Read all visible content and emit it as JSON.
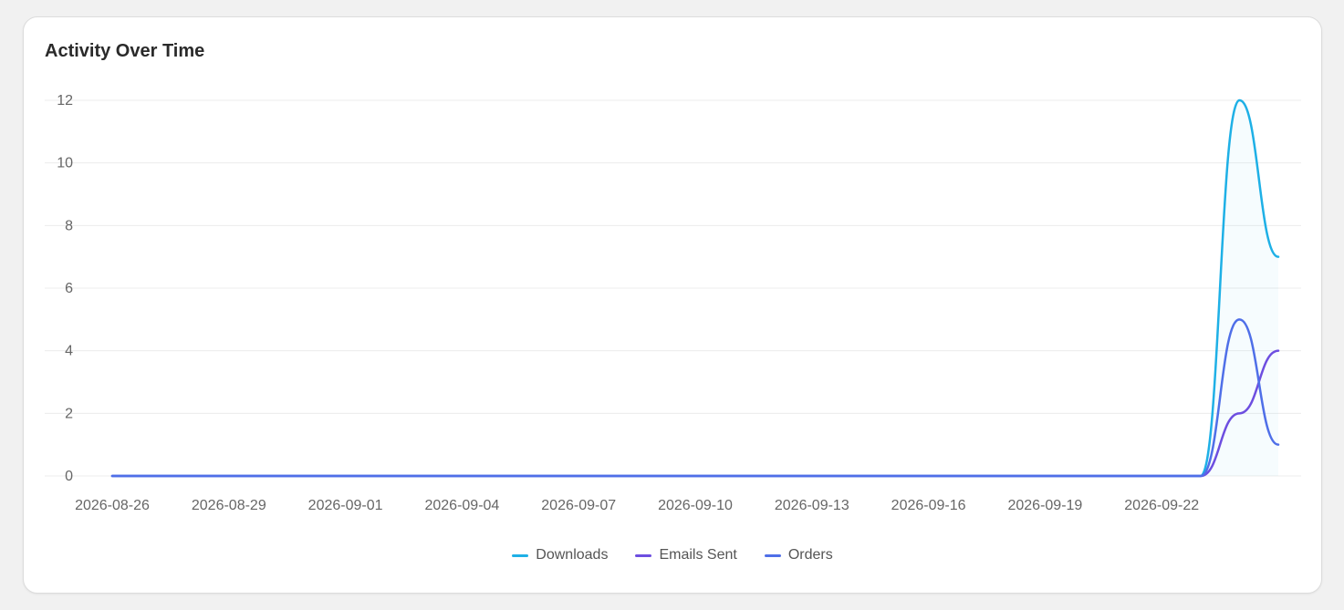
{
  "card": {
    "title": "Activity Over Time"
  },
  "chart_data": {
    "type": "line",
    "title": "Activity Over Time",
    "x": [
      "2026-08-26",
      "2026-08-27",
      "2026-08-28",
      "2026-08-29",
      "2026-08-30",
      "2026-08-31",
      "2026-09-01",
      "2026-09-02",
      "2026-09-03",
      "2026-09-04",
      "2026-09-05",
      "2026-09-06",
      "2026-09-07",
      "2026-09-08",
      "2026-09-09",
      "2026-09-10",
      "2026-09-11",
      "2026-09-12",
      "2026-09-13",
      "2026-09-14",
      "2026-09-15",
      "2026-09-16",
      "2026-09-17",
      "2026-09-18",
      "2026-09-19",
      "2026-09-20",
      "2026-09-21",
      "2026-09-22",
      "2026-09-23",
      "2026-09-24",
      "2026-09-25"
    ],
    "x_tick_labels": [
      "2026-08-26",
      "2026-08-29",
      "2026-09-01",
      "2026-09-04",
      "2026-09-07",
      "2026-09-10",
      "2026-09-13",
      "2026-09-16",
      "2026-09-19",
      "2026-09-22"
    ],
    "y_ticks": [
      0,
      2,
      4,
      6,
      8,
      10,
      12
    ],
    "ylim": [
      0,
      12
    ],
    "grid": true,
    "legend_position": "bottom-center",
    "series": [
      {
        "name": "Downloads",
        "color": "#1eb0e6",
        "values": [
          0,
          0,
          0,
          0,
          0,
          0,
          0,
          0,
          0,
          0,
          0,
          0,
          0,
          0,
          0,
          0,
          0,
          0,
          0,
          0,
          0,
          0,
          0,
          0,
          0,
          0,
          0,
          0,
          0,
          12,
          7
        ]
      },
      {
        "name": "Emails Sent",
        "color": "#6d4ee0",
        "values": [
          0,
          0,
          0,
          0,
          0,
          0,
          0,
          0,
          0,
          0,
          0,
          0,
          0,
          0,
          0,
          0,
          0,
          0,
          0,
          0,
          0,
          0,
          0,
          0,
          0,
          0,
          0,
          0,
          0,
          2,
          4
        ]
      },
      {
        "name": "Orders",
        "color": "#4f6fe8",
        "values": [
          0,
          0,
          0,
          0,
          0,
          0,
          0,
          0,
          0,
          0,
          0,
          0,
          0,
          0,
          0,
          0,
          0,
          0,
          0,
          0,
          0,
          0,
          0,
          0,
          0,
          0,
          0,
          0,
          0,
          5,
          1
        ]
      }
    ]
  }
}
